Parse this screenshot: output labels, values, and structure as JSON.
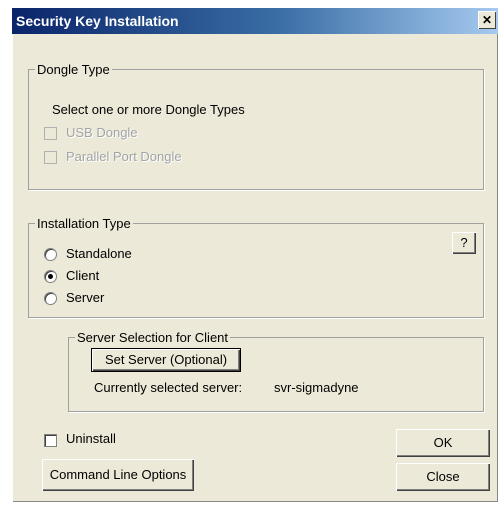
{
  "window": {
    "title": "Security Key Installation",
    "close_glyph": "✕"
  },
  "dongle": {
    "group_label": "Dongle Type",
    "instruction": "Select one or more Dongle Types",
    "options": [
      {
        "label": "USB Dongle",
        "checked": false,
        "enabled": false
      },
      {
        "label": "Parallel Port Dongle",
        "checked": false,
        "enabled": false
      }
    ]
  },
  "installation": {
    "group_label": "Installation Type",
    "help_label": "?",
    "options": [
      {
        "label": "Standalone",
        "selected": false
      },
      {
        "label": "Client",
        "selected": true
      },
      {
        "label": "Server",
        "selected": false
      }
    ]
  },
  "server_selection": {
    "group_label": "Server Selection for Client",
    "set_server_label": "Set Server (Optional)",
    "current_label": "Currently selected server:",
    "current_value": "svr-sigmadyne"
  },
  "uninstall": {
    "label": "Uninstall",
    "checked": false
  },
  "buttons": {
    "command_line": "Command Line Options",
    "ok": "OK",
    "close": "Close"
  }
}
